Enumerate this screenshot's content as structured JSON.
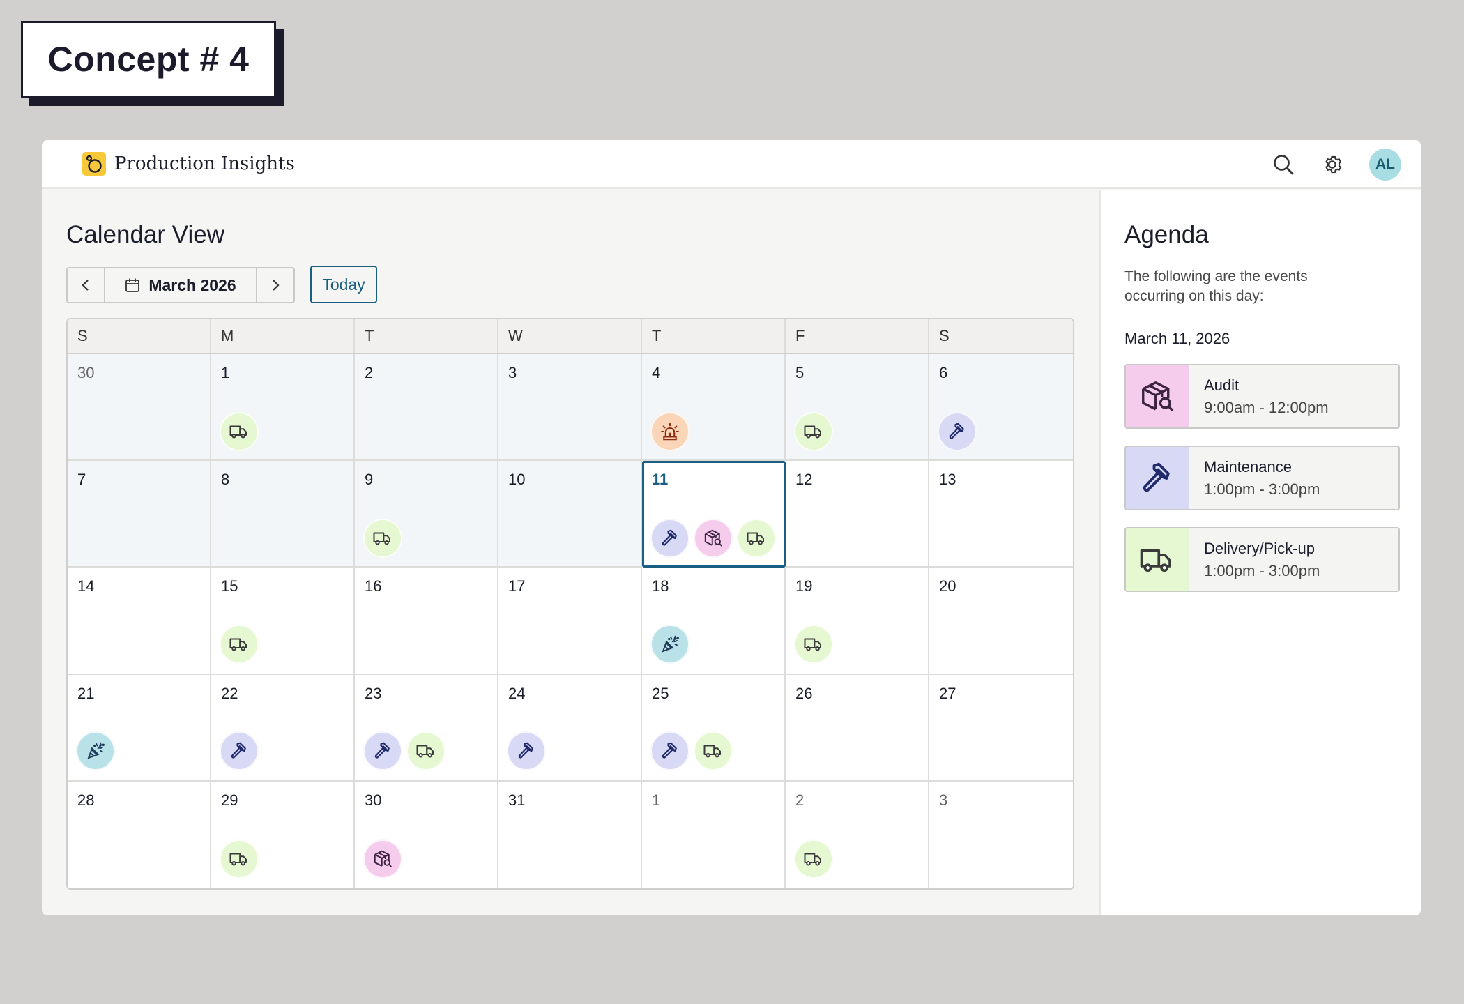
{
  "concept_label": "Concept # 4",
  "app": {
    "title": "Production Insights"
  },
  "header": {
    "search_icon": "search-icon",
    "settings_icon": "gear-icon",
    "avatar_initials": "AL"
  },
  "calendar": {
    "title": "Calendar View",
    "month_label": "March 2026",
    "today_label": "Today",
    "weekdays": [
      "S",
      "M",
      "T",
      "W",
      "T",
      "F",
      "S"
    ],
    "selected_day": "11",
    "days": [
      {
        "d": "30",
        "events": [],
        "other": true,
        "past": true
      },
      {
        "d": "1",
        "events": [
          "truck"
        ],
        "past": true
      },
      {
        "d": "2",
        "events": [],
        "past": true
      },
      {
        "d": "3",
        "events": [],
        "past": true
      },
      {
        "d": "4",
        "events": [
          "alarm"
        ],
        "past": true
      },
      {
        "d": "5",
        "events": [
          "truck"
        ],
        "past": true
      },
      {
        "d": "6",
        "events": [
          "hammer"
        ],
        "past": true
      },
      {
        "d": "7",
        "events": [],
        "past": true
      },
      {
        "d": "8",
        "events": [],
        "past": true
      },
      {
        "d": "9",
        "events": [
          "truck"
        ],
        "past": true
      },
      {
        "d": "10",
        "events": [],
        "past": true
      },
      {
        "d": "11",
        "events": [
          "hammer",
          "audit",
          "truck"
        ],
        "selected": true
      },
      {
        "d": "12",
        "events": []
      },
      {
        "d": "13",
        "events": []
      },
      {
        "d": "14",
        "events": []
      },
      {
        "d": "15",
        "events": [
          "truck"
        ]
      },
      {
        "d": "16",
        "events": []
      },
      {
        "d": "17",
        "events": []
      },
      {
        "d": "18",
        "events": [
          "party"
        ]
      },
      {
        "d": "19",
        "events": [
          "truck"
        ]
      },
      {
        "d": "20",
        "events": []
      },
      {
        "d": "21",
        "events": [
          "party"
        ]
      },
      {
        "d": "22",
        "events": [
          "hammer"
        ]
      },
      {
        "d": "23",
        "events": [
          "hammer",
          "truck"
        ]
      },
      {
        "d": "24",
        "events": [
          "hammer"
        ]
      },
      {
        "d": "25",
        "events": [
          "hammer",
          "truck"
        ]
      },
      {
        "d": "26",
        "events": []
      },
      {
        "d": "27",
        "events": []
      },
      {
        "d": "28",
        "events": []
      },
      {
        "d": "29",
        "events": [
          "truck"
        ]
      },
      {
        "d": "30",
        "events": [
          "audit"
        ]
      },
      {
        "d": "31",
        "events": []
      },
      {
        "d": "1",
        "events": [],
        "other": true
      },
      {
        "d": "2",
        "events": [
          "truck"
        ],
        "other": true
      },
      {
        "d": "3",
        "events": [],
        "other": true
      }
    ]
  },
  "agenda": {
    "title": "Agenda",
    "description": "The following are the events occurring on this day:",
    "date": "March 11, 2026",
    "items": [
      {
        "type": "audit",
        "name": "Audit",
        "time": "9:00am - 12:00pm",
        "color": "#f5ccec"
      },
      {
        "type": "hammer",
        "name": "Maintenance",
        "time": "1:00pm - 3:00pm",
        "color": "#d8d9f5"
      },
      {
        "type": "truck",
        "name": "Delivery/Pick-up",
        "time": "1:00pm - 3:00pm",
        "color": "#e6f8d2"
      }
    ]
  },
  "event_icons": {
    "truck": "truck-icon",
    "hammer": "hammer-icon",
    "audit": "package-search-icon",
    "alarm": "siren-icon",
    "party": "party-popper-icon"
  },
  "colors": {
    "accent": "#1a5f82",
    "truck": "#e6f8d2",
    "hammer": "#d8d9f5",
    "audit": "#f5ccec",
    "alarm": "#fbd5b7",
    "party": "#b8e2e8"
  }
}
